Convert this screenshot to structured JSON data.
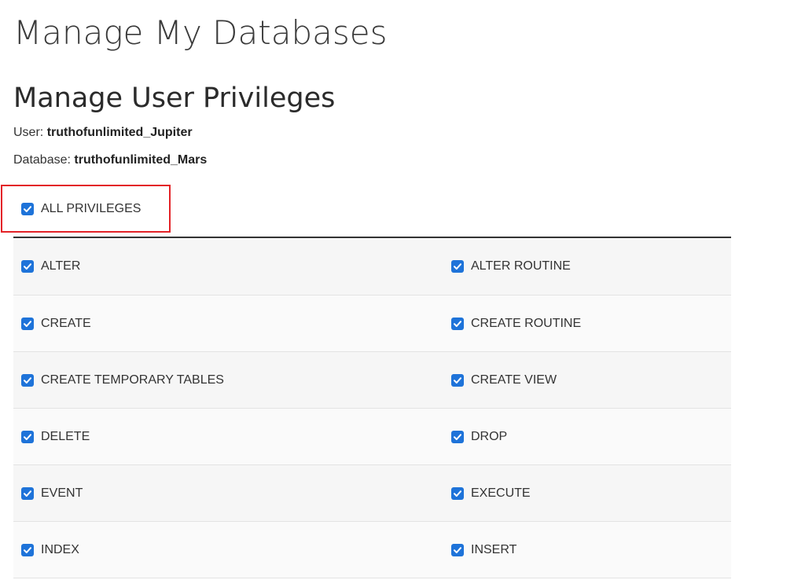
{
  "page": {
    "title": "Manage My Databases",
    "section_title": "Manage User Privileges"
  },
  "meta": {
    "user_label": "User:",
    "user_value": "truthofunlimited_Jupiter",
    "db_label": "Database:",
    "db_value": "truthofunlimited_Mars"
  },
  "all_privileges": {
    "label": "ALL PRIVILEGES",
    "checked": true
  },
  "highlight_color": "#e32227",
  "checkbox_color": "#1e73d9",
  "privileges": [
    {
      "left": "ALTER",
      "right": "ALTER ROUTINE"
    },
    {
      "left": "CREATE",
      "right": "CREATE ROUTINE"
    },
    {
      "left": "CREATE TEMPORARY TABLES",
      "right": "CREATE VIEW"
    },
    {
      "left": "DELETE",
      "right": "DROP"
    },
    {
      "left": "EVENT",
      "right": "EXECUTE"
    },
    {
      "left": "INDEX",
      "right": "INSERT"
    }
  ]
}
